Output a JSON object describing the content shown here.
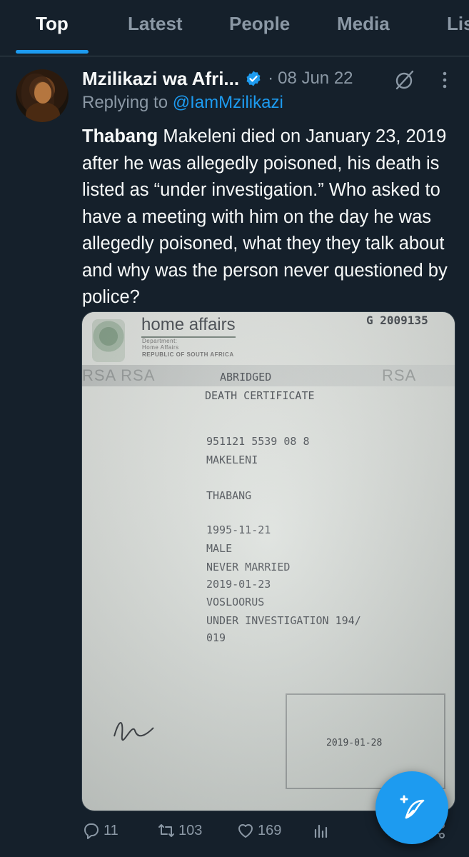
{
  "tabs": [
    {
      "label": "Top",
      "active": true
    },
    {
      "label": "Latest",
      "active": false
    },
    {
      "label": "People",
      "active": false
    },
    {
      "label": "Media",
      "active": false
    },
    {
      "label": "Lis",
      "active": false
    }
  ],
  "tweet": {
    "display_name": "Mzilikazi wa Afri...",
    "date": "08 Jun 22",
    "reply_prefix": "Replying to",
    "reply_handle": "@IamMzilikazi",
    "text_bold": "Thabang",
    "text_rest": " Makeleni died on January 23, 2019 after he was allegedly poisoned, his death is listed as “under investigation.” Who asked to have a meeting with him on the day he was allegedly poisoned, what they they talk about and why was the person never questioned by police?",
    "actions": {
      "replies": "11",
      "retweets": "103",
      "likes": "169"
    }
  },
  "certificate": {
    "header": "home affairs",
    "dept_line1": "Department:",
    "dept_line2": "Home Affairs",
    "dept_line3": "REPUBLIC OF SOUTH AFRICA",
    "serial": "G 2009135",
    "rsa": "RSA RSA",
    "title1": "ABRIDGED",
    "title2": "DEATH CERTIFICATE",
    "id_number": "951121 5539 08 8",
    "surname": "MAKELENI",
    "forenames": "THABANG",
    "dob": "1995-11-21",
    "gender": "MALE",
    "marital": "NEVER MARRIED",
    "death_date": "2019-01-23",
    "place": "VOSLOORUS",
    "cause1": "UNDER INVESTIGATION 194/",
    "cause2": "019",
    "stamp_date": "2019-01-28"
  },
  "colors": {
    "background": "#15202b",
    "accent": "#1d9bf0",
    "muted": "#8b98a5",
    "text": "#f7f9f9"
  },
  "icons": {
    "verified": "verified-badge-icon",
    "grok": "grok-icon",
    "more": "more-icon",
    "reply": "reply-icon",
    "retweet": "retweet-icon",
    "like": "heart-icon",
    "views": "views-icon",
    "bookmark": "bookmark-icon",
    "share": "share-icon",
    "compose": "compose-post-icon"
  }
}
